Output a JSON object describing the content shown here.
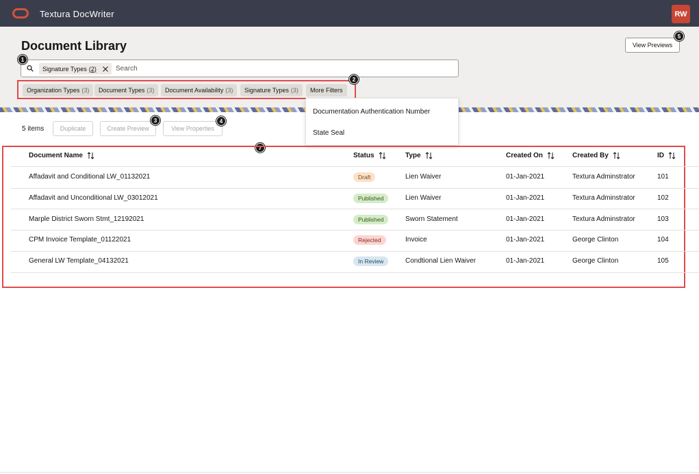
{
  "app": {
    "title": "Textura DocWriter",
    "user_initials": "RW"
  },
  "page": {
    "title": "Document Library",
    "view_previews_label": "View Previews"
  },
  "search": {
    "chip_label": "Signature Types",
    "chip_count": "(2)",
    "placeholder": "Search"
  },
  "filters": [
    {
      "label": "Organization Types",
      "count": "(3)"
    },
    {
      "label": "Document Types",
      "count": "(3)"
    },
    {
      "label": "Document Availability",
      "count": "(3)"
    },
    {
      "label": "Signature Types",
      "count": "(3)"
    },
    {
      "label": "More Filters",
      "count": ""
    }
  ],
  "dropdown": {
    "items": [
      "Documentation Authentication Number",
      "State Seal"
    ]
  },
  "toolbar": {
    "items_count": "5 items",
    "duplicate": "Duplicate",
    "create_preview": "Create Preview",
    "view_properties": "View Properties"
  },
  "callouts": [
    "1",
    "2",
    "3",
    "4",
    "5",
    "7"
  ],
  "table": {
    "columns": [
      "Document Name",
      "Status",
      "Type",
      "Created On",
      "Created By",
      "ID"
    ],
    "rows": [
      {
        "name": "Affadavit and Conditional LW_01132021",
        "status": "Draft",
        "type": "Lien Waiver",
        "created_on": "01-Jan-2021",
        "created_by": "Textura Adminstrator",
        "id": "101"
      },
      {
        "name": "Affadavit and Unconditional LW_03012021",
        "status": "Published",
        "type": "Lien Waiver",
        "created_on": "01-Jan-2021",
        "created_by": "Textura Adminstrator",
        "id": "102"
      },
      {
        "name": "Marple District Sworn Stmt_12192021",
        "status": "Published",
        "type": "Sworn Statement",
        "created_on": "01-Jan-2021",
        "created_by": "Textura Adminstrator",
        "id": "103"
      },
      {
        "name": "CPM Invoice Template_01122021",
        "status": "Rejected",
        "type": "Invoice",
        "created_on": "01-Jan-2021",
        "created_by": "George Clinton",
        "id": "104"
      },
      {
        "name": "General LW Template_04132021",
        "status": "In Review",
        "type": "Condtional Lien Waiver",
        "created_on": "01-Jan-2021",
        "created_by": "George Clinton",
        "id": "105"
      }
    ]
  },
  "status_colors": {
    "Draft": {
      "bg": "#fbe1c9",
      "fg": "#7a4a1c"
    },
    "Published": {
      "bg": "#d6ebc8",
      "fg": "#2f5a1c"
    },
    "Rejected": {
      "bg": "#fad6d2",
      "fg": "#8a2b22"
    },
    "In Review": {
      "bg": "#d7e6f0",
      "fg": "#2b4c63"
    }
  },
  "colors": {
    "topbar": "#3a3d4c",
    "accent": "#c74634",
    "annotation": "#e04a4a"
  }
}
